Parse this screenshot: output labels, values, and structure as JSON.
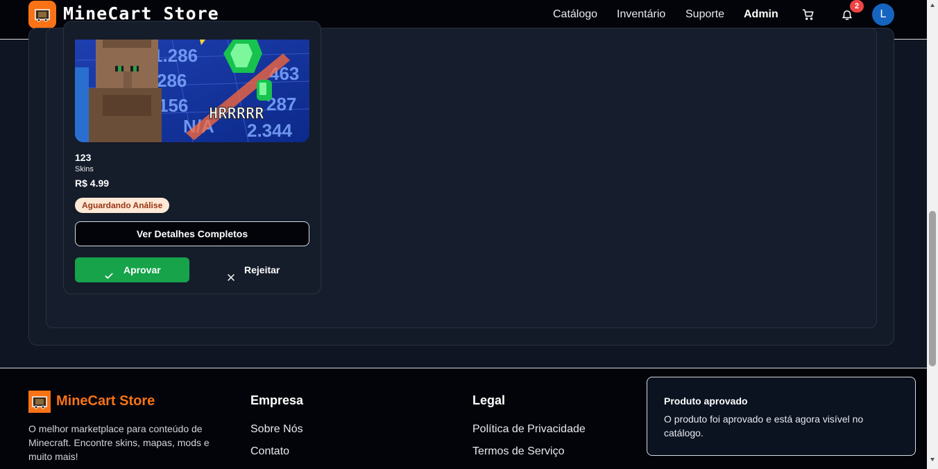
{
  "header": {
    "brand": "MineCart Store",
    "nav": [
      "Catálogo",
      "Inventário",
      "Suporte",
      "Admin"
    ],
    "notification_count": "2",
    "avatar_initial": "L",
    "icons": [
      "cart-icon",
      "bell-icon"
    ]
  },
  "product": {
    "image_texts": {
      "caption": "HRRRRR",
      "numbers": [
        "1.286",
        "286",
        "463",
        "156",
        "287",
        "2.344",
        "N/A"
      ]
    },
    "name": "123",
    "category": "Skins",
    "price": "R$ 4.99",
    "status": "Aguardando Análise",
    "details_label": "Ver Detalhes Completos",
    "approve_label": "Aprovar",
    "reject_label": "Rejeitar"
  },
  "footer": {
    "brand": "MineCart Store",
    "description": "O melhor marketplace para conteúdo de Minecraft. Encontre skins, mapas, mods e muito mais!",
    "company": {
      "heading": "Empresa",
      "links": [
        "Sobre Nós",
        "Contato"
      ]
    },
    "legal": {
      "heading": "Legal",
      "links": [
        "Política de Privacidade",
        "Termos de Serviço"
      ]
    }
  },
  "toast": {
    "title": "Produto aprovado",
    "message": "O produto foi aprovado e está agora visível no catálogo."
  },
  "colors": {
    "accent": "#f97316",
    "approve": "#16a34a",
    "badge": "#ef4444",
    "avatar": "#1565c0"
  }
}
